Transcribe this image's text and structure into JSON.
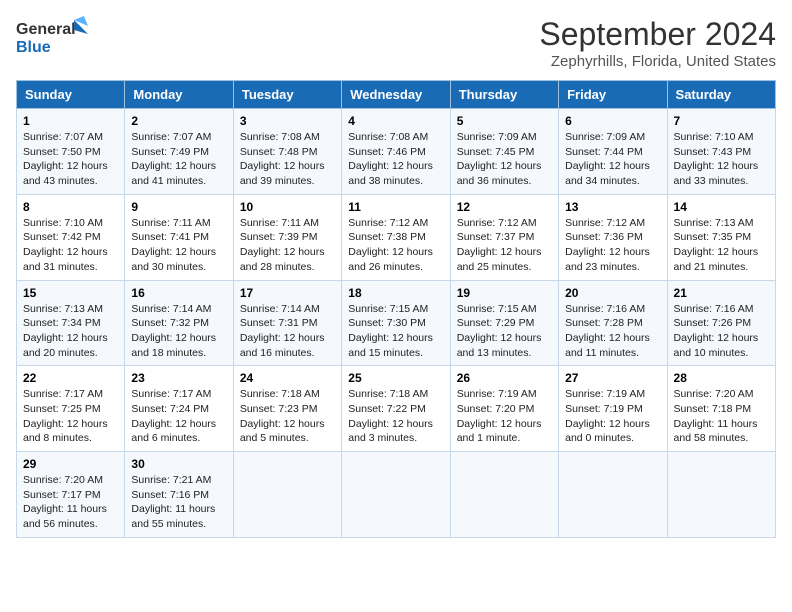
{
  "logo": {
    "line1": "General",
    "line2": "Blue"
  },
  "title": "September 2024",
  "subtitle": "Zephyrhills, Florida, United States",
  "weekdays": [
    "Sunday",
    "Monday",
    "Tuesday",
    "Wednesday",
    "Thursday",
    "Friday",
    "Saturday"
  ],
  "weeks": [
    [
      {
        "day": "1",
        "info": "Sunrise: 7:07 AM\nSunset: 7:50 PM\nDaylight: 12 hours\nand 43 minutes."
      },
      {
        "day": "2",
        "info": "Sunrise: 7:07 AM\nSunset: 7:49 PM\nDaylight: 12 hours\nand 41 minutes."
      },
      {
        "day": "3",
        "info": "Sunrise: 7:08 AM\nSunset: 7:48 PM\nDaylight: 12 hours\nand 39 minutes."
      },
      {
        "day": "4",
        "info": "Sunrise: 7:08 AM\nSunset: 7:46 PM\nDaylight: 12 hours\nand 38 minutes."
      },
      {
        "day": "5",
        "info": "Sunrise: 7:09 AM\nSunset: 7:45 PM\nDaylight: 12 hours\nand 36 minutes."
      },
      {
        "day": "6",
        "info": "Sunrise: 7:09 AM\nSunset: 7:44 PM\nDaylight: 12 hours\nand 34 minutes."
      },
      {
        "day": "7",
        "info": "Sunrise: 7:10 AM\nSunset: 7:43 PM\nDaylight: 12 hours\nand 33 minutes."
      }
    ],
    [
      {
        "day": "8",
        "info": "Sunrise: 7:10 AM\nSunset: 7:42 PM\nDaylight: 12 hours\nand 31 minutes."
      },
      {
        "day": "9",
        "info": "Sunrise: 7:11 AM\nSunset: 7:41 PM\nDaylight: 12 hours\nand 30 minutes."
      },
      {
        "day": "10",
        "info": "Sunrise: 7:11 AM\nSunset: 7:39 PM\nDaylight: 12 hours\nand 28 minutes."
      },
      {
        "day": "11",
        "info": "Sunrise: 7:12 AM\nSunset: 7:38 PM\nDaylight: 12 hours\nand 26 minutes."
      },
      {
        "day": "12",
        "info": "Sunrise: 7:12 AM\nSunset: 7:37 PM\nDaylight: 12 hours\nand 25 minutes."
      },
      {
        "day": "13",
        "info": "Sunrise: 7:12 AM\nSunset: 7:36 PM\nDaylight: 12 hours\nand 23 minutes."
      },
      {
        "day": "14",
        "info": "Sunrise: 7:13 AM\nSunset: 7:35 PM\nDaylight: 12 hours\nand 21 minutes."
      }
    ],
    [
      {
        "day": "15",
        "info": "Sunrise: 7:13 AM\nSunset: 7:34 PM\nDaylight: 12 hours\nand 20 minutes."
      },
      {
        "day": "16",
        "info": "Sunrise: 7:14 AM\nSunset: 7:32 PM\nDaylight: 12 hours\nand 18 minutes."
      },
      {
        "day": "17",
        "info": "Sunrise: 7:14 AM\nSunset: 7:31 PM\nDaylight: 12 hours\nand 16 minutes."
      },
      {
        "day": "18",
        "info": "Sunrise: 7:15 AM\nSunset: 7:30 PM\nDaylight: 12 hours\nand 15 minutes."
      },
      {
        "day": "19",
        "info": "Sunrise: 7:15 AM\nSunset: 7:29 PM\nDaylight: 12 hours\nand 13 minutes."
      },
      {
        "day": "20",
        "info": "Sunrise: 7:16 AM\nSunset: 7:28 PM\nDaylight: 12 hours\nand 11 minutes."
      },
      {
        "day": "21",
        "info": "Sunrise: 7:16 AM\nSunset: 7:26 PM\nDaylight: 12 hours\nand 10 minutes."
      }
    ],
    [
      {
        "day": "22",
        "info": "Sunrise: 7:17 AM\nSunset: 7:25 PM\nDaylight: 12 hours\nand 8 minutes."
      },
      {
        "day": "23",
        "info": "Sunrise: 7:17 AM\nSunset: 7:24 PM\nDaylight: 12 hours\nand 6 minutes."
      },
      {
        "day": "24",
        "info": "Sunrise: 7:18 AM\nSunset: 7:23 PM\nDaylight: 12 hours\nand 5 minutes."
      },
      {
        "day": "25",
        "info": "Sunrise: 7:18 AM\nSunset: 7:22 PM\nDaylight: 12 hours\nand 3 minutes."
      },
      {
        "day": "26",
        "info": "Sunrise: 7:19 AM\nSunset: 7:20 PM\nDaylight: 12 hours\nand 1 minute."
      },
      {
        "day": "27",
        "info": "Sunrise: 7:19 AM\nSunset: 7:19 PM\nDaylight: 12 hours\nand 0 minutes."
      },
      {
        "day": "28",
        "info": "Sunrise: 7:20 AM\nSunset: 7:18 PM\nDaylight: 11 hours\nand 58 minutes."
      }
    ],
    [
      {
        "day": "29",
        "info": "Sunrise: 7:20 AM\nSunset: 7:17 PM\nDaylight: 11 hours\nand 56 minutes."
      },
      {
        "day": "30",
        "info": "Sunrise: 7:21 AM\nSunset: 7:16 PM\nDaylight: 11 hours\nand 55 minutes."
      },
      null,
      null,
      null,
      null,
      null
    ]
  ]
}
